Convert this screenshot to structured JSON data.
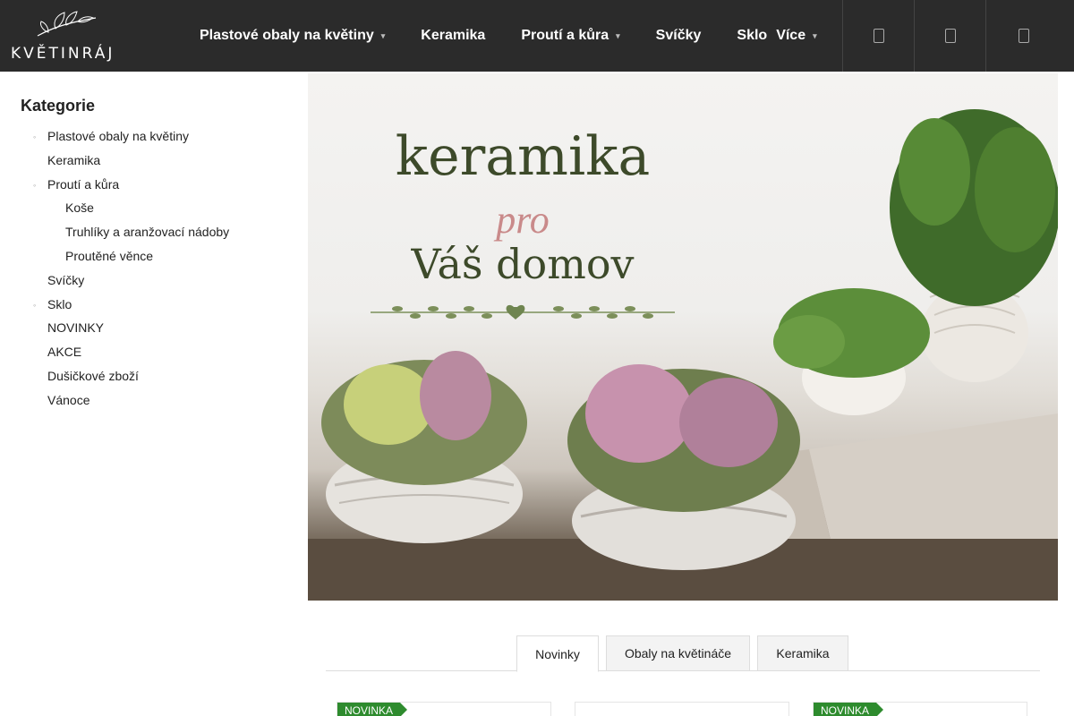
{
  "header": {
    "logo_text": "KVĚTINRÁJ",
    "nav": [
      {
        "label": "Plastové obaly na květiny",
        "has_submenu": true
      },
      {
        "label": "Keramika",
        "has_submenu": false
      },
      {
        "label": "Proutí a kůra",
        "has_submenu": true
      },
      {
        "label": "Svíčky",
        "has_submenu": false
      },
      {
        "label": "Sklo",
        "has_submenu": false
      },
      {
        "label": "Více",
        "has_submenu": true
      }
    ],
    "icons": [
      "search-icon",
      "user-icon",
      "cart-icon"
    ]
  },
  "sidebar": {
    "title": "Kategorie",
    "items": [
      {
        "label": "Plastové obaly na květiny",
        "bullet": true
      },
      {
        "label": "Keramika",
        "bullet": false
      },
      {
        "label": "Proutí a kůra",
        "bullet": true
      },
      {
        "label": "Koše",
        "bullet": false
      },
      {
        "label": "Truhlíky a aranžovací nádoby",
        "bullet": false
      },
      {
        "label": "Proutěné věnce",
        "bullet": false
      },
      {
        "label": "Svíčky",
        "bullet": false
      },
      {
        "label": "Sklo",
        "bullet": true
      },
      {
        "label": "NOVINKY",
        "bullet": false
      },
      {
        "label": "AKCE",
        "bullet": false
      },
      {
        "label": "Dušičkové zboží",
        "bullet": false
      },
      {
        "label": "Vánoce",
        "bullet": false
      }
    ]
  },
  "banner": {
    "line1": "keramika",
    "line2": "pro",
    "line3": "Váš domov"
  },
  "tabs": [
    {
      "label": "Novinky",
      "active": true
    },
    {
      "label": "Obaly na květináče",
      "active": false
    },
    {
      "label": "Keramika",
      "active": false
    }
  ],
  "products": [
    {
      "flag": "NOVINKA"
    },
    {
      "flag": ""
    },
    {
      "flag": "NOVINKA"
    }
  ],
  "colors": {
    "header_bg": "#2b2b2b",
    "flag_green": "#2e8b2e",
    "banner_green": "#3d4a2a",
    "banner_pink": "#c98a8a"
  }
}
